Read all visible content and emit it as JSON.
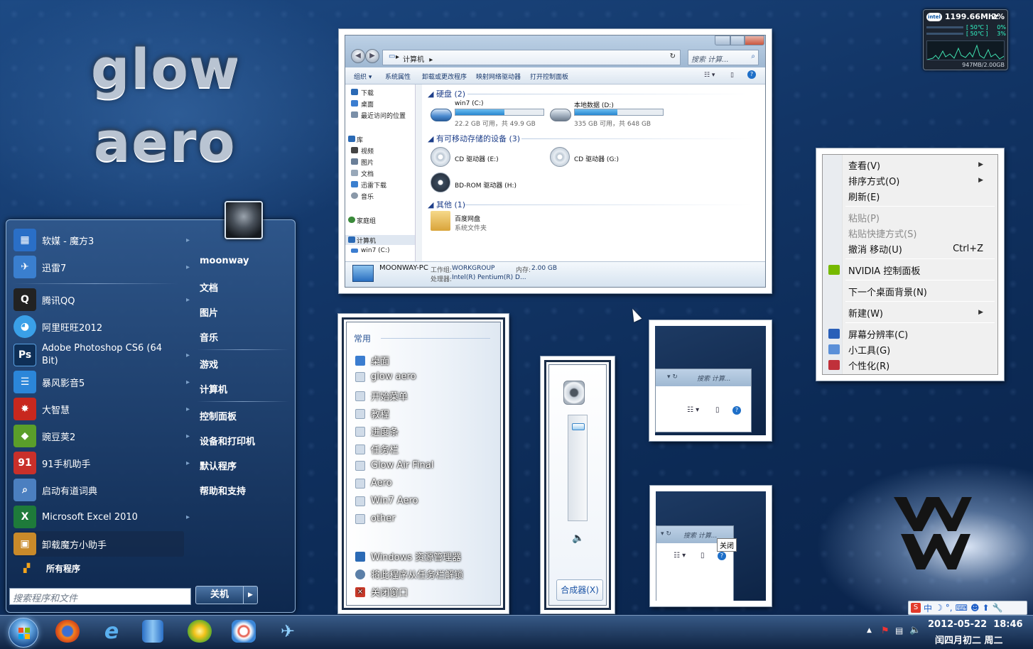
{
  "desktop": {
    "logo_line1": "glow",
    "logo_line2": "aero"
  },
  "gadget": {
    "cpu_freq": "1199.66Mhz",
    "cpu_percent": "2%",
    "core1_temp": "[ 50℃ ]",
    "core1_pct": "0%",
    "core2_temp": "[ 50℃ ]",
    "core2_pct": "3%",
    "memory": "947MB/2.00GB",
    "intel": "intel"
  },
  "start_menu": {
    "user": "moonway",
    "programs": [
      {
        "label": "软媒 - 魔方3",
        "icon": "mofang-icon",
        "color": "#2a6fc7"
      },
      {
        "label": "迅雷7",
        "icon": "xunlei-icon",
        "color": "#3a7fcf"
      },
      {
        "label": "腾讯QQ",
        "icon": "qq-icon",
        "color": "#222"
      },
      {
        "label": "阿里旺旺2012",
        "icon": "wangwang-icon",
        "color": "#3aa0e8"
      },
      {
        "label": "Adobe Photoshop CS6 (64 Bit)",
        "icon": "photoshop-icon",
        "color": "#0e2f57"
      },
      {
        "label": "暴风影音5",
        "icon": "baofeng-icon",
        "color": "#2b86d9"
      },
      {
        "label": "大智慧",
        "icon": "dazhihui-icon",
        "color": "#c8281e"
      },
      {
        "label": "豌豆荚2",
        "icon": "wandoujia-icon",
        "color": "#5a9e2a"
      },
      {
        "label": "91手机助手",
        "icon": "91-icon",
        "color": "#c9302a"
      },
      {
        "label": "启动有道词典",
        "icon": "youdao-icon",
        "color": "#4b7fc0"
      },
      {
        "label": "Microsoft Excel 2010",
        "icon": "excel-icon",
        "color": "#1e7a3a"
      },
      {
        "label": "卸载魔方小助手",
        "icon": "uninstall-icon",
        "color": "#c98a2a"
      }
    ],
    "all_programs": "所有程序",
    "right_items": [
      "moonway",
      "文档",
      "图片",
      "音乐",
      "游戏",
      "计算机",
      "控制面板",
      "设备和打印机",
      "默认程序",
      "帮助和支持"
    ],
    "search_placeholder": "搜索程序和文件",
    "shutdown_label": "关机"
  },
  "explorer": {
    "breadcrumb": "计算机",
    "search_placeholder": "搜索 计算...",
    "toolbar": [
      "组织 ▾",
      "系统属性",
      "卸载或更改程序",
      "映射网络驱动器",
      "打开控制面板"
    ],
    "nav": {
      "favorites": [
        "下载",
        "桌面",
        "最近访问的位置"
      ],
      "library_title": "库",
      "libraries": [
        "视频",
        "图片",
        "文档",
        "迅雷下载",
        "音乐"
      ],
      "homegroup": "家庭组",
      "computer": "计算机",
      "win7": "win7 (C:)"
    },
    "group_hdd": "硬盘 (2)",
    "group_removable": "有可移动存储的设备 (3)",
    "group_other": "其他 (1)",
    "drives": [
      {
        "name": "win7 (C:)",
        "free": "22.2 GB 可用，共 49.9 GB",
        "used_fraction": 0.56
      },
      {
        "name": "本地数据 (D:)",
        "free": "335 GB 可用，共 648 GB",
        "used_fraction": 0.48
      }
    ],
    "removable": [
      "CD 驱动器 (E:)",
      "CD 驱动器 (G:)",
      "BD-ROM 驱动器 (H:)"
    ],
    "other_name": "百度网盘",
    "other_sub": "系统文件夹",
    "status_pc": "MOONWAY-PC",
    "status_wg_label": "工作组:",
    "status_wg": "WORKGROUP",
    "status_mem_label": "内存:",
    "status_mem": "2.00 GB",
    "status_cpu_label": "处理器:",
    "status_cpu": "Intel(R) Pentium(R) D..."
  },
  "jumplist": {
    "header": "常用",
    "items": [
      "桌面",
      "glow aero",
      "开始菜单",
      "教程",
      "进度条",
      "任务栏",
      "Glow Air Final",
      "Aero",
      "Win7 Aero",
      "other"
    ],
    "tasks": [
      "Windows 资源管理器",
      "将此程序从任务栏解锁",
      "关闭窗口"
    ]
  },
  "volume": {
    "level": 0.92,
    "mixer_label": "合成器(X)"
  },
  "thumbnails": {
    "search_text": "搜索 计算...",
    "close_tooltip": "关闭"
  },
  "context_menu": {
    "items": [
      {
        "label": "查看(V)",
        "submenu": true
      },
      {
        "label": "排序方式(O)",
        "submenu": true
      },
      {
        "label": "刷新(E)"
      },
      {
        "label": "粘贴(P)",
        "disabled": true
      },
      {
        "label": "粘贴快捷方式(S)",
        "disabled": true
      },
      {
        "label": "撤消 移动(U)",
        "shortcut": "Ctrl+Z"
      },
      {
        "label": "NVIDIA 控制面板"
      },
      {
        "label": "下一个桌面背景(N)"
      },
      {
        "label": "新建(W)",
        "submenu": true
      },
      {
        "label": "屏幕分辨率(C)"
      },
      {
        "label": "小工具(G)"
      },
      {
        "label": "个性化(R)"
      }
    ]
  },
  "ime": {
    "label": "中"
  },
  "taskbar": {
    "date": "2012-05-22",
    "time": "18:46",
    "lunar": "闰四月初二 周二",
    "pinned": [
      "firefox-icon",
      "ie-icon",
      "explorer-icon",
      "wandoujia-icon",
      "baofeng-icon",
      "xunlei-icon"
    ]
  }
}
